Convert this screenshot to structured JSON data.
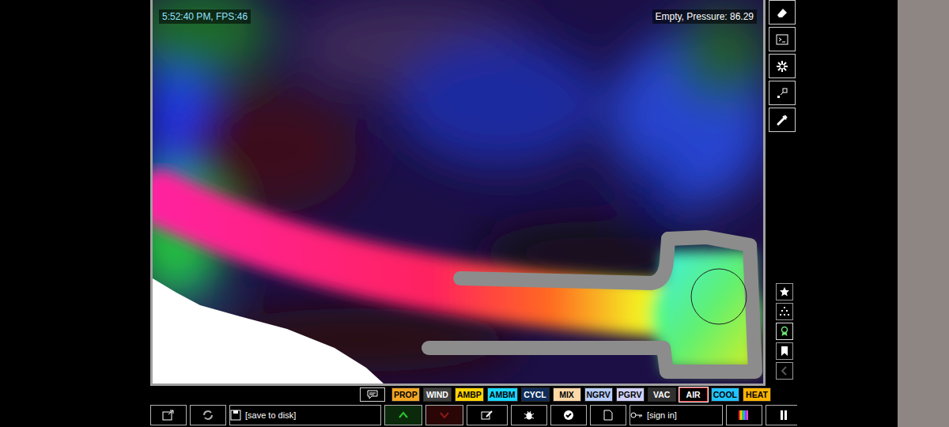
{
  "hud": {
    "clock_fps": "5:52:40 PM, FPS:46",
    "status": "Empty, Pressure: 86.29"
  },
  "menu_sections": [
    {
      "selected": false,
      "disabled": false
    },
    {
      "selected": false,
      "disabled": false
    },
    {
      "selected": true,
      "disabled": false
    },
    {
      "selected": false,
      "disabled": false
    },
    {
      "selected": false,
      "disabled": true
    }
  ],
  "elements": [
    {
      "label": "PROP",
      "color": "#f5a623",
      "selected": false
    },
    {
      "label": "WIND",
      "color": "#404040",
      "selected": false
    },
    {
      "label": "AMBP",
      "color": "#ffd400",
      "selected": false
    },
    {
      "label": "AMBM",
      "color": "#17d8ff",
      "selected": false
    },
    {
      "label": "CYCL",
      "color": "#0e2d5b",
      "selected": false
    },
    {
      "label": "MIX",
      "color": "#ffd8a8",
      "selected": false
    },
    {
      "label": "NGRV",
      "color": "#b8cdf8",
      "selected": false
    },
    {
      "label": "PGRV",
      "color": "#d0d0f8",
      "selected": false
    },
    {
      "label": "VAC",
      "color": "#303030",
      "selected": false
    },
    {
      "label": "AIR",
      "color": "#000000",
      "selected": true
    },
    {
      "label": "COOL",
      "color": "#22c3ff",
      "selected": false
    },
    {
      "label": "HEAT",
      "color": "#ffb300",
      "selected": false
    }
  ],
  "bottom_bar": {
    "save_label": "[save to disk]",
    "sign_in_label": "[sign in]"
  }
}
